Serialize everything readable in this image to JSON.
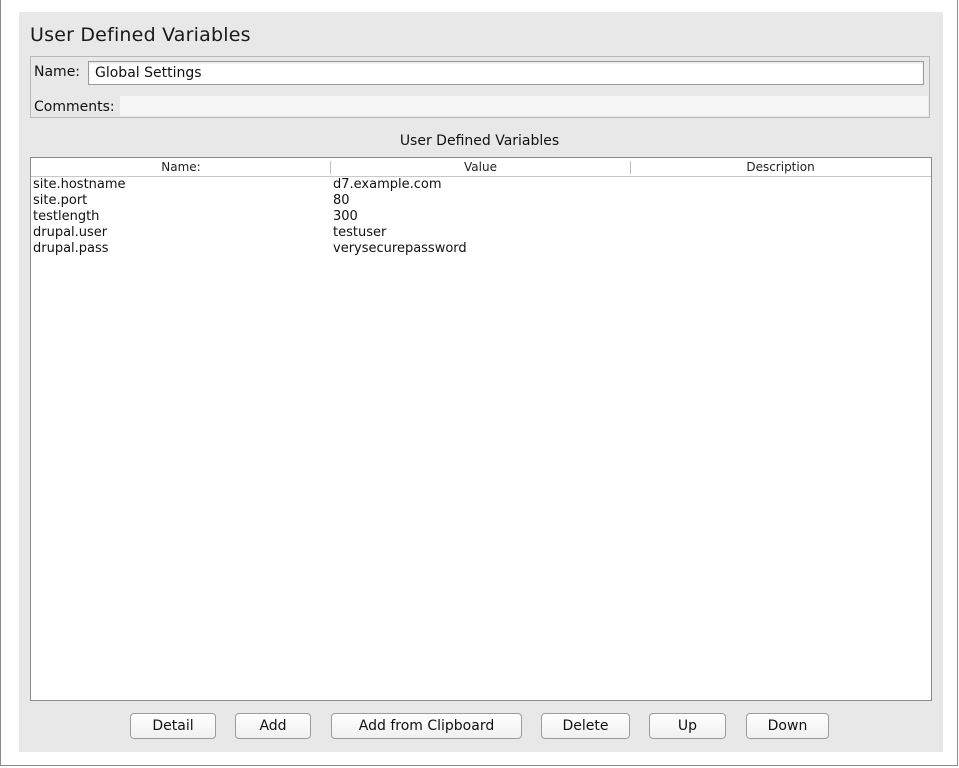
{
  "panel": {
    "title": "User Defined Variables",
    "name_label": "Name:",
    "name_value": "Global Settings",
    "comments_label": "Comments:",
    "comments_value": ""
  },
  "table": {
    "caption": "User Defined Variables",
    "headers": [
      "Name:",
      "Value",
      "Description"
    ],
    "rows": [
      {
        "name": "site.hostname",
        "value": "d7.example.com",
        "description": ""
      },
      {
        "name": "site.port",
        "value": "80",
        "description": ""
      },
      {
        "name": "testlength",
        "value": "300",
        "description": ""
      },
      {
        "name": "drupal.user",
        "value": "testuser",
        "description": ""
      },
      {
        "name": "drupal.pass",
        "value": "verysecurepassword",
        "description": ""
      }
    ]
  },
  "buttons": {
    "detail": "Detail",
    "add": "Add",
    "add_from_clipboard": "Add from Clipboard",
    "delete": "Delete",
    "up": "Up",
    "down": "Down"
  }
}
